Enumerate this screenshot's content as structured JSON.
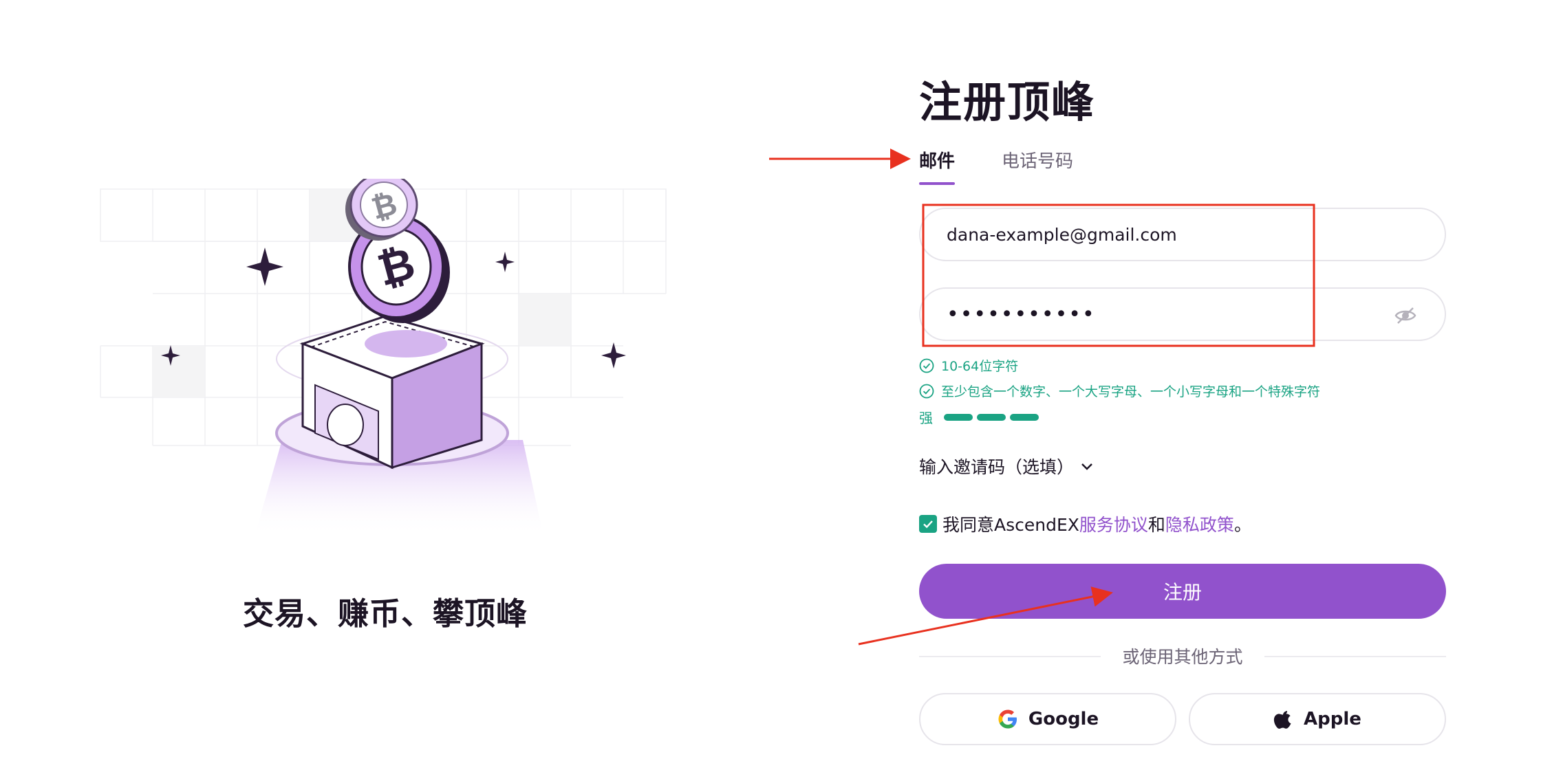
{
  "hero": {
    "tagline": "交易、赚币、攀顶峰"
  },
  "form": {
    "title": "注册顶峰",
    "tabs": [
      {
        "label": "邮件",
        "active": true
      },
      {
        "label": "电话号码",
        "active": false
      }
    ],
    "email_value": "dana-example@gmail.com",
    "password_value": "•••••••••••",
    "password_rules": [
      {
        "text": "10-64位字符",
        "met": true
      },
      {
        "text": "至少包含一个数字、一个大写字母、一个小写字母和一个特殊字符",
        "met": true
      }
    ],
    "strength": {
      "label": "强",
      "level": 3,
      "max": 3
    },
    "invite_label": "输入邀请码（选填）",
    "agree": {
      "checked": true,
      "prefix": "我同意AscendEX",
      "terms_link": "服务协议",
      "conjunction": "和",
      "privacy_link": "隐私政策",
      "suffix": "。"
    },
    "submit_label": "注册",
    "divider_text": "或使用其他方式",
    "social": [
      {
        "label": "Google",
        "icon": "google-icon"
      },
      {
        "label": "Apple",
        "icon": "apple-icon"
      }
    ]
  },
  "colors": {
    "accent": "#9152cc",
    "success": "#1aa383",
    "annotation": "#e8311f",
    "text": "#1c1424"
  }
}
